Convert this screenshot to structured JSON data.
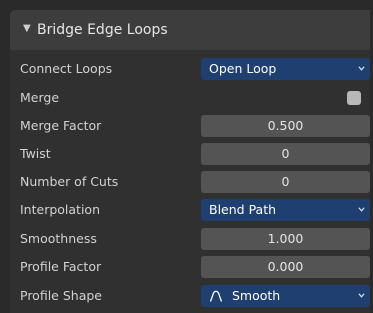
{
  "panel": {
    "title": "Bridge Edge Loops",
    "collapse_icon": "disclosure-triangle-down-icon"
  },
  "fields": {
    "connect_loops": {
      "label": "Connect Loops",
      "value": "Open Loop",
      "icon": "chevron-down-icon"
    },
    "merge": {
      "label": "Merge",
      "checked": false
    },
    "merge_factor": {
      "label": "Merge Factor",
      "value": "0.500"
    },
    "twist": {
      "label": "Twist",
      "value": "0"
    },
    "number_of_cuts": {
      "label": "Number of Cuts",
      "value": "0"
    },
    "interpolation": {
      "label": "Interpolation",
      "value": "Blend Path",
      "icon": "chevron-down-icon"
    },
    "smoothness": {
      "label": "Smoothness",
      "value": "1.000"
    },
    "profile_factor": {
      "label": "Profile Factor",
      "value": "0.000"
    },
    "profile_shape": {
      "label": "Profile Shape",
      "value": "Smooth",
      "icon": "smooth-curve-icon"
    }
  },
  "colors": {
    "dropdown_bg": "#1f3f70",
    "field_bg": "#545454",
    "panel_bg": "#303030",
    "header_bg": "#3d3d3d"
  }
}
